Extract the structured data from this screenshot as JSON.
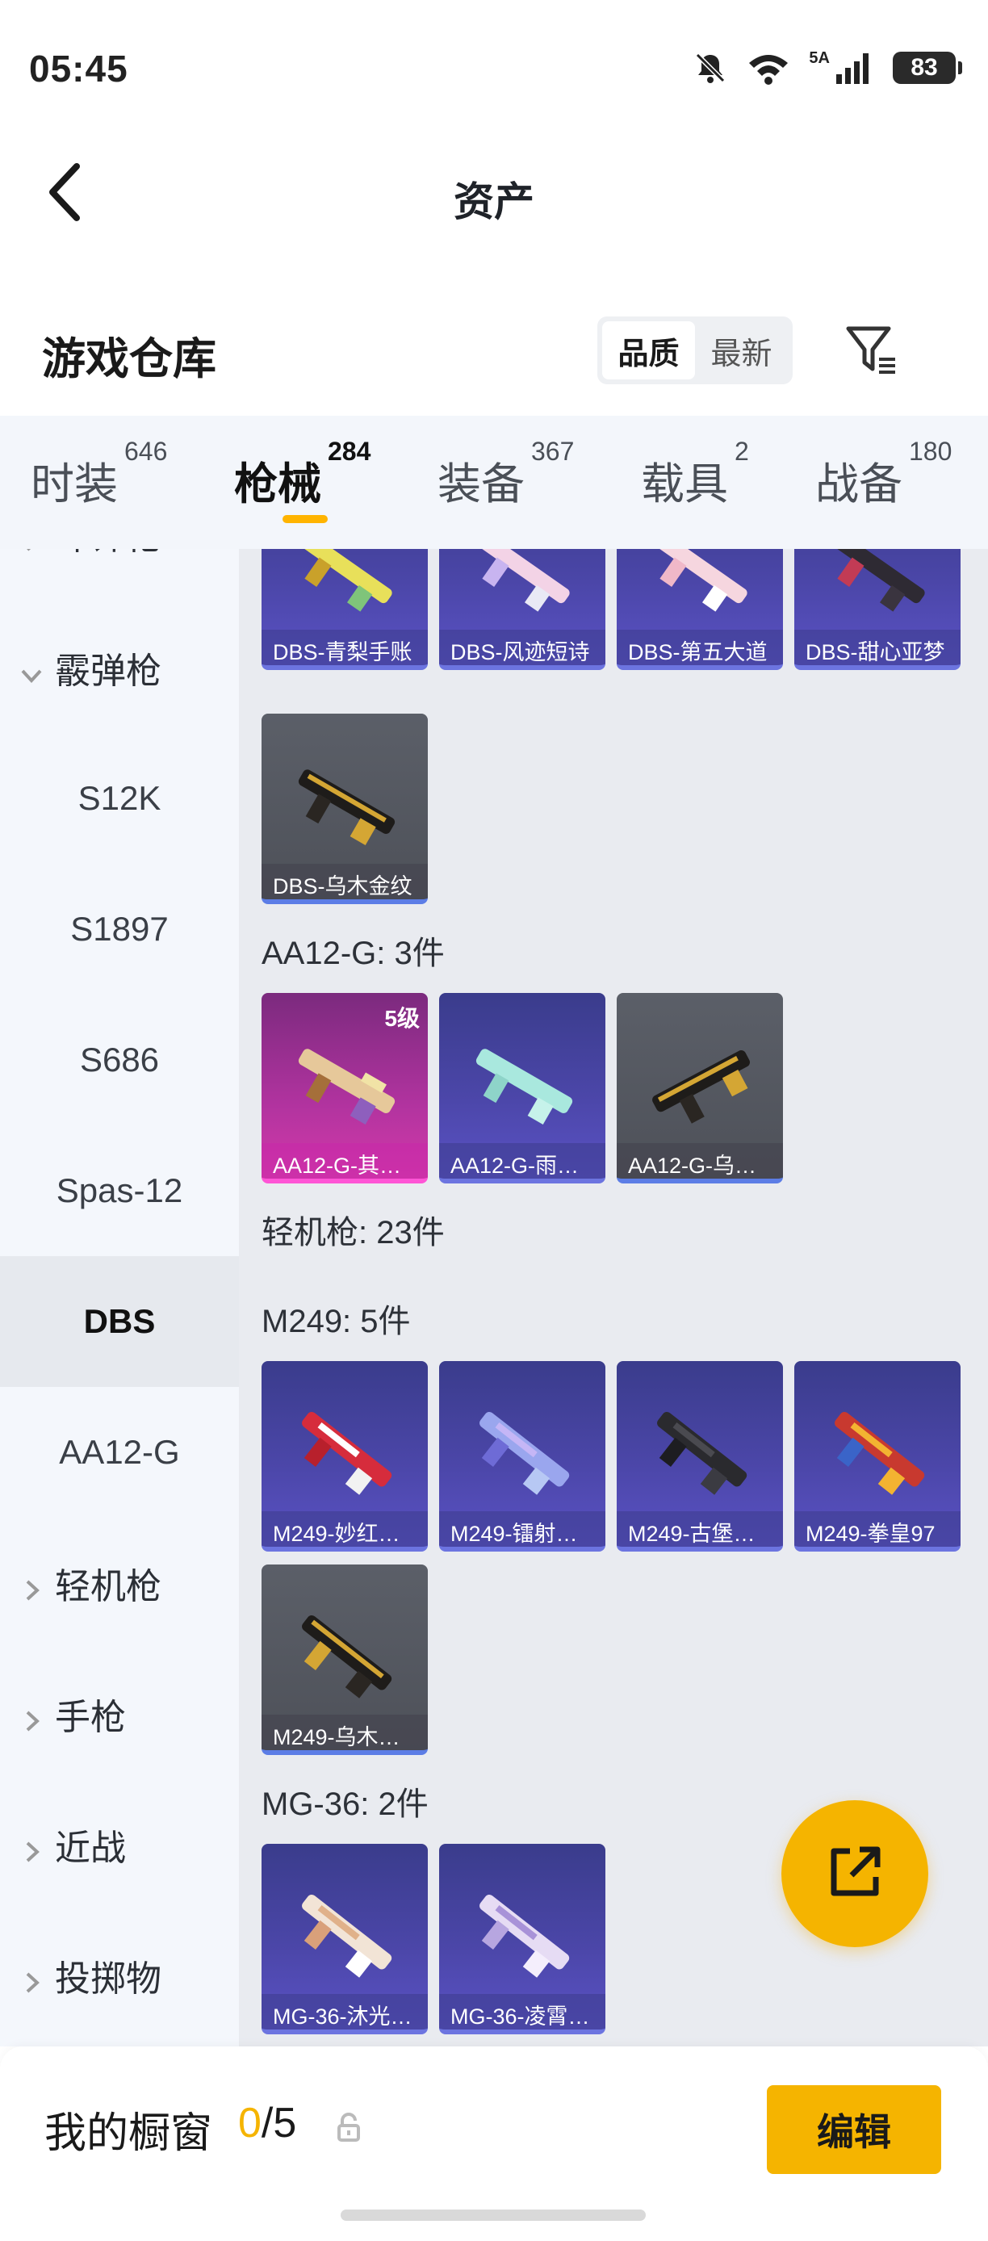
{
  "status_bar": {
    "time": "05:45",
    "network": "5A",
    "battery": "83"
  },
  "title_bar": {
    "title": "资产"
  },
  "warehouse": {
    "title": "游戏仓库",
    "sort_options": [
      "品质",
      "最新"
    ],
    "active_sort": "品质"
  },
  "tabs": [
    {
      "label": "时装",
      "count": "646"
    },
    {
      "label": "枪械",
      "count": "284"
    },
    {
      "label": "装备",
      "count": "367"
    },
    {
      "label": "载具",
      "count": "2"
    },
    {
      "label": "战备",
      "count": "180"
    }
  ],
  "active_tab": "枪械",
  "sidebar": {
    "items": [
      {
        "label": "冲锋枪",
        "type": "group"
      },
      {
        "label": "霰弹枪",
        "type": "group-open"
      },
      {
        "label": "S12K",
        "type": "sub"
      },
      {
        "label": "S1897",
        "type": "sub"
      },
      {
        "label": "S686",
        "type": "sub"
      },
      {
        "label": "Spas-12",
        "type": "sub"
      },
      {
        "label": "DBS",
        "type": "sub-active"
      },
      {
        "label": "AA12-G",
        "type": "sub"
      },
      {
        "label": "轻机枪",
        "type": "group"
      },
      {
        "label": "手枪",
        "type": "group"
      },
      {
        "label": "近战",
        "type": "group"
      },
      {
        "label": "投掷物",
        "type": "group"
      }
    ]
  },
  "sections": {
    "dbs_items": [
      "DBS-青梨手账",
      "DBS-风迹短诗",
      "DBS-第五大道",
      "DBS-甜心亚梦",
      "DBS-乌木金纹"
    ],
    "aa12": {
      "label": "AA12-G: 3件",
      "items": [
        "AA12-G-其…",
        "AA12-G-雨…",
        "AA12-G-乌…"
      ],
      "level": "5级"
    },
    "lmg": {
      "label": "轻机枪: 23件"
    },
    "m249": {
      "label": "M249: 5件",
      "items": [
        "M249-妙红…",
        "M249-镭射…",
        "M249-古堡…",
        "M249-拳皇97",
        "M249-乌木…"
      ]
    },
    "mg36": {
      "label": "MG-36: 2件",
      "items": [
        "MG-36-沐光…",
        "MG-36-凌霄…"
      ]
    }
  },
  "bottom_bar": {
    "my_window_label": "我的橱窗",
    "used": "0",
    "total": "/5",
    "edit_label": "编辑"
  },
  "colors": {
    "accent": "#f5b400",
    "epic_card": "#4b46a8",
    "common_card": "#55585f",
    "legendary_card": "#b1339f"
  }
}
